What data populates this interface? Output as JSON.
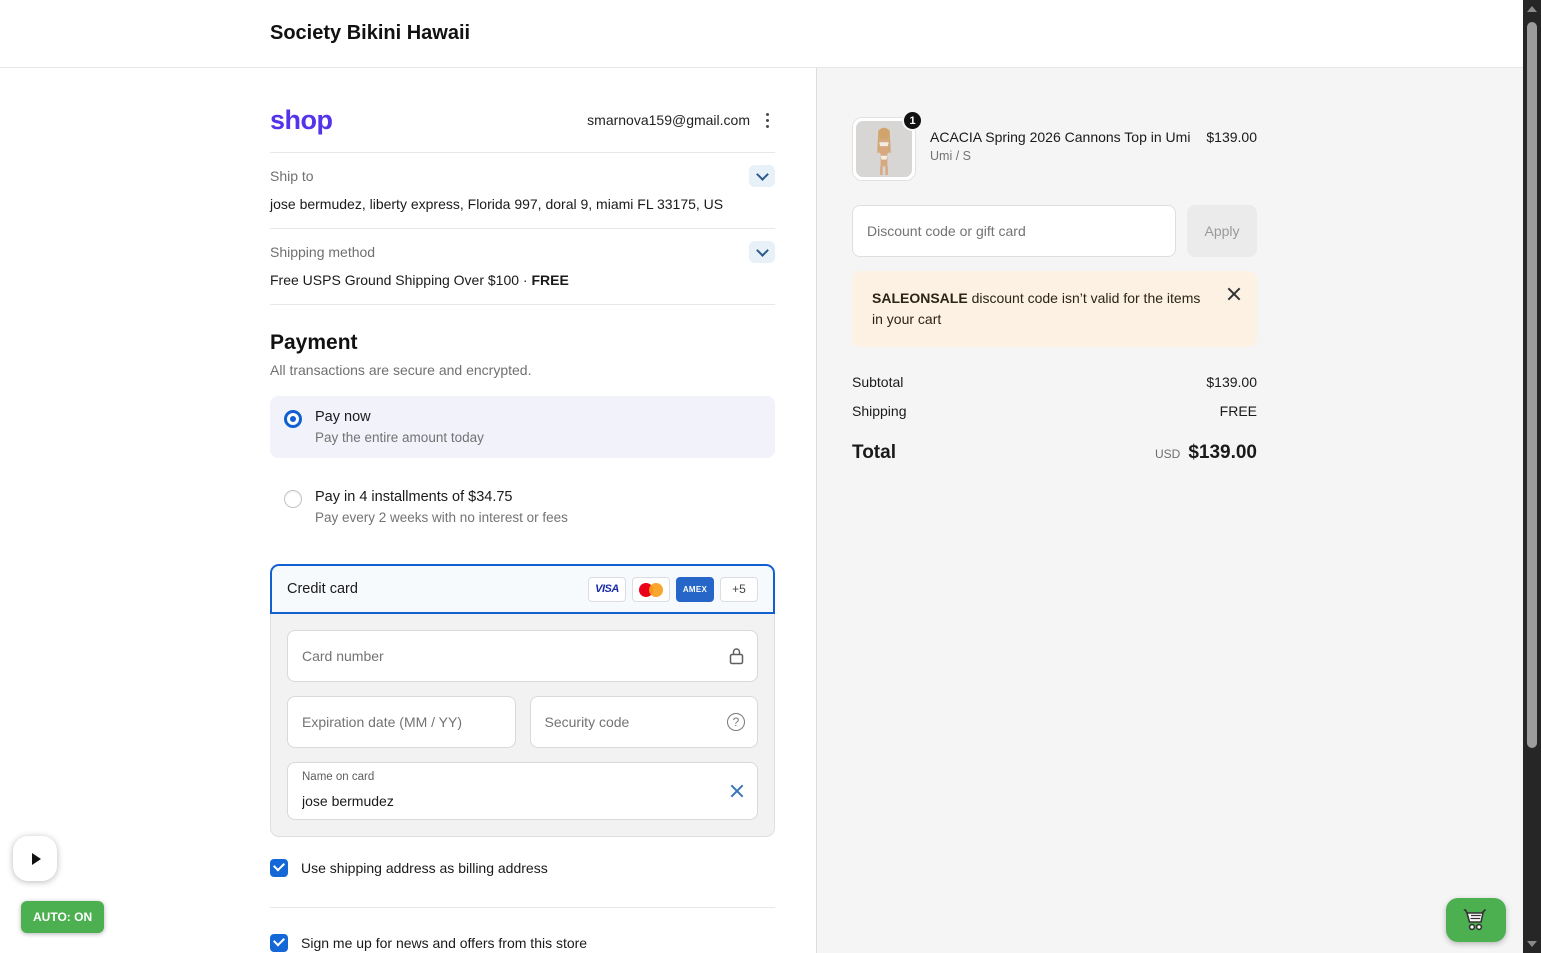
{
  "header": {
    "store_name": "Society Bikini Hawaii"
  },
  "express": {
    "logo_text": "shop",
    "email": "smarnova159@gmail.com"
  },
  "ship_to": {
    "label": "Ship to",
    "address": "jose bermudez, liberty express, Florida 997, doral 9, miami FL 33175, US"
  },
  "shipping_method": {
    "label": "Shipping method",
    "value": "Free USPS Ground Shipping Over $100 · ",
    "value_bold": "FREE"
  },
  "payment": {
    "title": "Payment",
    "subtitle": "All transactions are secure and encrypted.",
    "options": [
      {
        "label": "Pay now",
        "description": "Pay the entire amount today"
      },
      {
        "label": "Pay in 4 installments of $34.75",
        "description": "Pay every 2 weeks with no interest or fees"
      }
    ],
    "credit_card": {
      "label": "Credit card",
      "badges": {
        "visa": "VISA",
        "amex": "AMEX",
        "more": "+5"
      },
      "card_number_placeholder": "Card number",
      "expiry_placeholder": "Expiration date (MM / YY)",
      "security_placeholder": "Security code",
      "name_label": "Name on card",
      "name_value": "jose bermudez"
    },
    "billing_checkbox_label": "Use shipping address as billing address",
    "news_checkbox_label": "Sign me up for news and offers from this store"
  },
  "summary": {
    "item": {
      "quantity": "1",
      "name": "ACACIA Spring 2026 Cannons Top in Umi",
      "variant": "Umi / S",
      "price": "$139.00"
    },
    "discount": {
      "placeholder": "Discount code or gift card",
      "apply_label": "Apply"
    },
    "error": {
      "code": "SALEONSALE",
      "message": " discount code isn’t valid for the items in your cart"
    },
    "totals": {
      "subtotal_label": "Subtotal",
      "subtotal_value": "$139.00",
      "shipping_label": "Shipping",
      "shipping_value": "FREE",
      "total_label": "Total",
      "currency": "USD",
      "total_value": "$139.00"
    }
  },
  "overlay": {
    "auto_badge": "AUTO: ON"
  },
  "icons": {
    "help": "?"
  },
  "colors": {
    "accent_blue": "#1160d1",
    "shop_purple": "#5433eb",
    "green": "#4caf50",
    "error_bg": "#fcf1e2",
    "panel_gray": "#f5f5f5"
  }
}
